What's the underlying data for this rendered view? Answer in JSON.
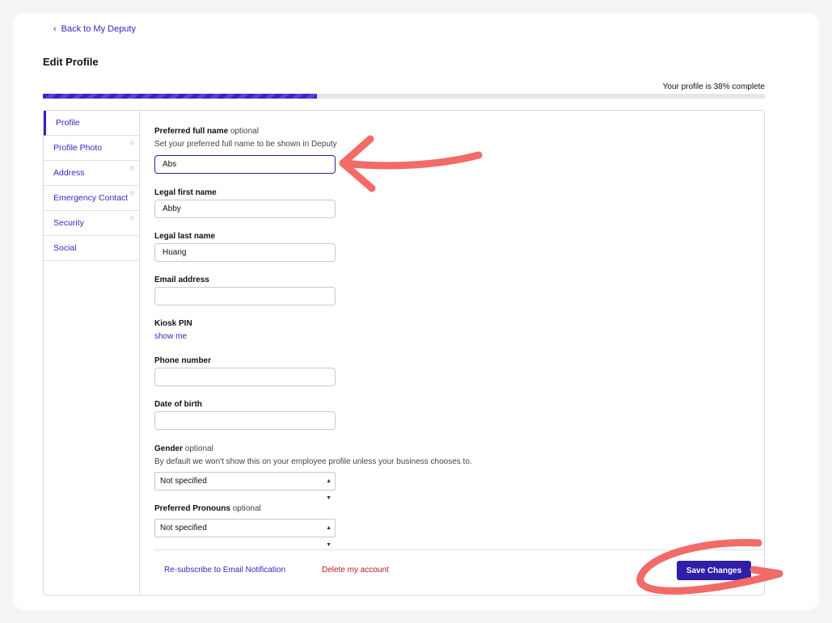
{
  "nav": {
    "back_label": "Back to My Deputy"
  },
  "page": {
    "title": "Edit Profile"
  },
  "progress": {
    "text": "Your profile is 38% complete",
    "percent": 38
  },
  "sidebar": {
    "items": [
      {
        "label": "Profile",
        "active": true
      },
      {
        "label": "Profile Photo"
      },
      {
        "label": "Address"
      },
      {
        "label": "Emergency Contact"
      },
      {
        "label": "Security"
      },
      {
        "label": "Social"
      }
    ]
  },
  "form": {
    "preferred_name": {
      "label": "Preferred full name",
      "optional": "optional",
      "help": "Set your preferred full name to be shown in Deputy",
      "value": "Abs"
    },
    "legal_first": {
      "label": "Legal first name",
      "value": "Abby"
    },
    "legal_last": {
      "label": "Legal last name",
      "value": "Huang"
    },
    "email": {
      "label": "Email address",
      "value": ""
    },
    "kiosk": {
      "label": "Kiosk PIN",
      "link": "show me"
    },
    "phone": {
      "label": "Phone number",
      "value": ""
    },
    "dob": {
      "label": "Date of birth",
      "value": ""
    },
    "gender": {
      "label": "Gender",
      "optional": "optional",
      "help": "By default we won't show this on your employee profile unless your business chooses to.",
      "value": "Not specified"
    },
    "pronouns": {
      "label": "Preferred Pronouns",
      "optional": "optional",
      "value": "Not specified"
    }
  },
  "footer": {
    "resubscribe": "Re-subscribe to Email Notification",
    "delete": "Delete my account",
    "save": "Save Changes"
  },
  "colors": {
    "accent": "#2d1fa8",
    "link": "#3a1fbf",
    "danger": "#c01818",
    "annotation": "#f26b66"
  }
}
